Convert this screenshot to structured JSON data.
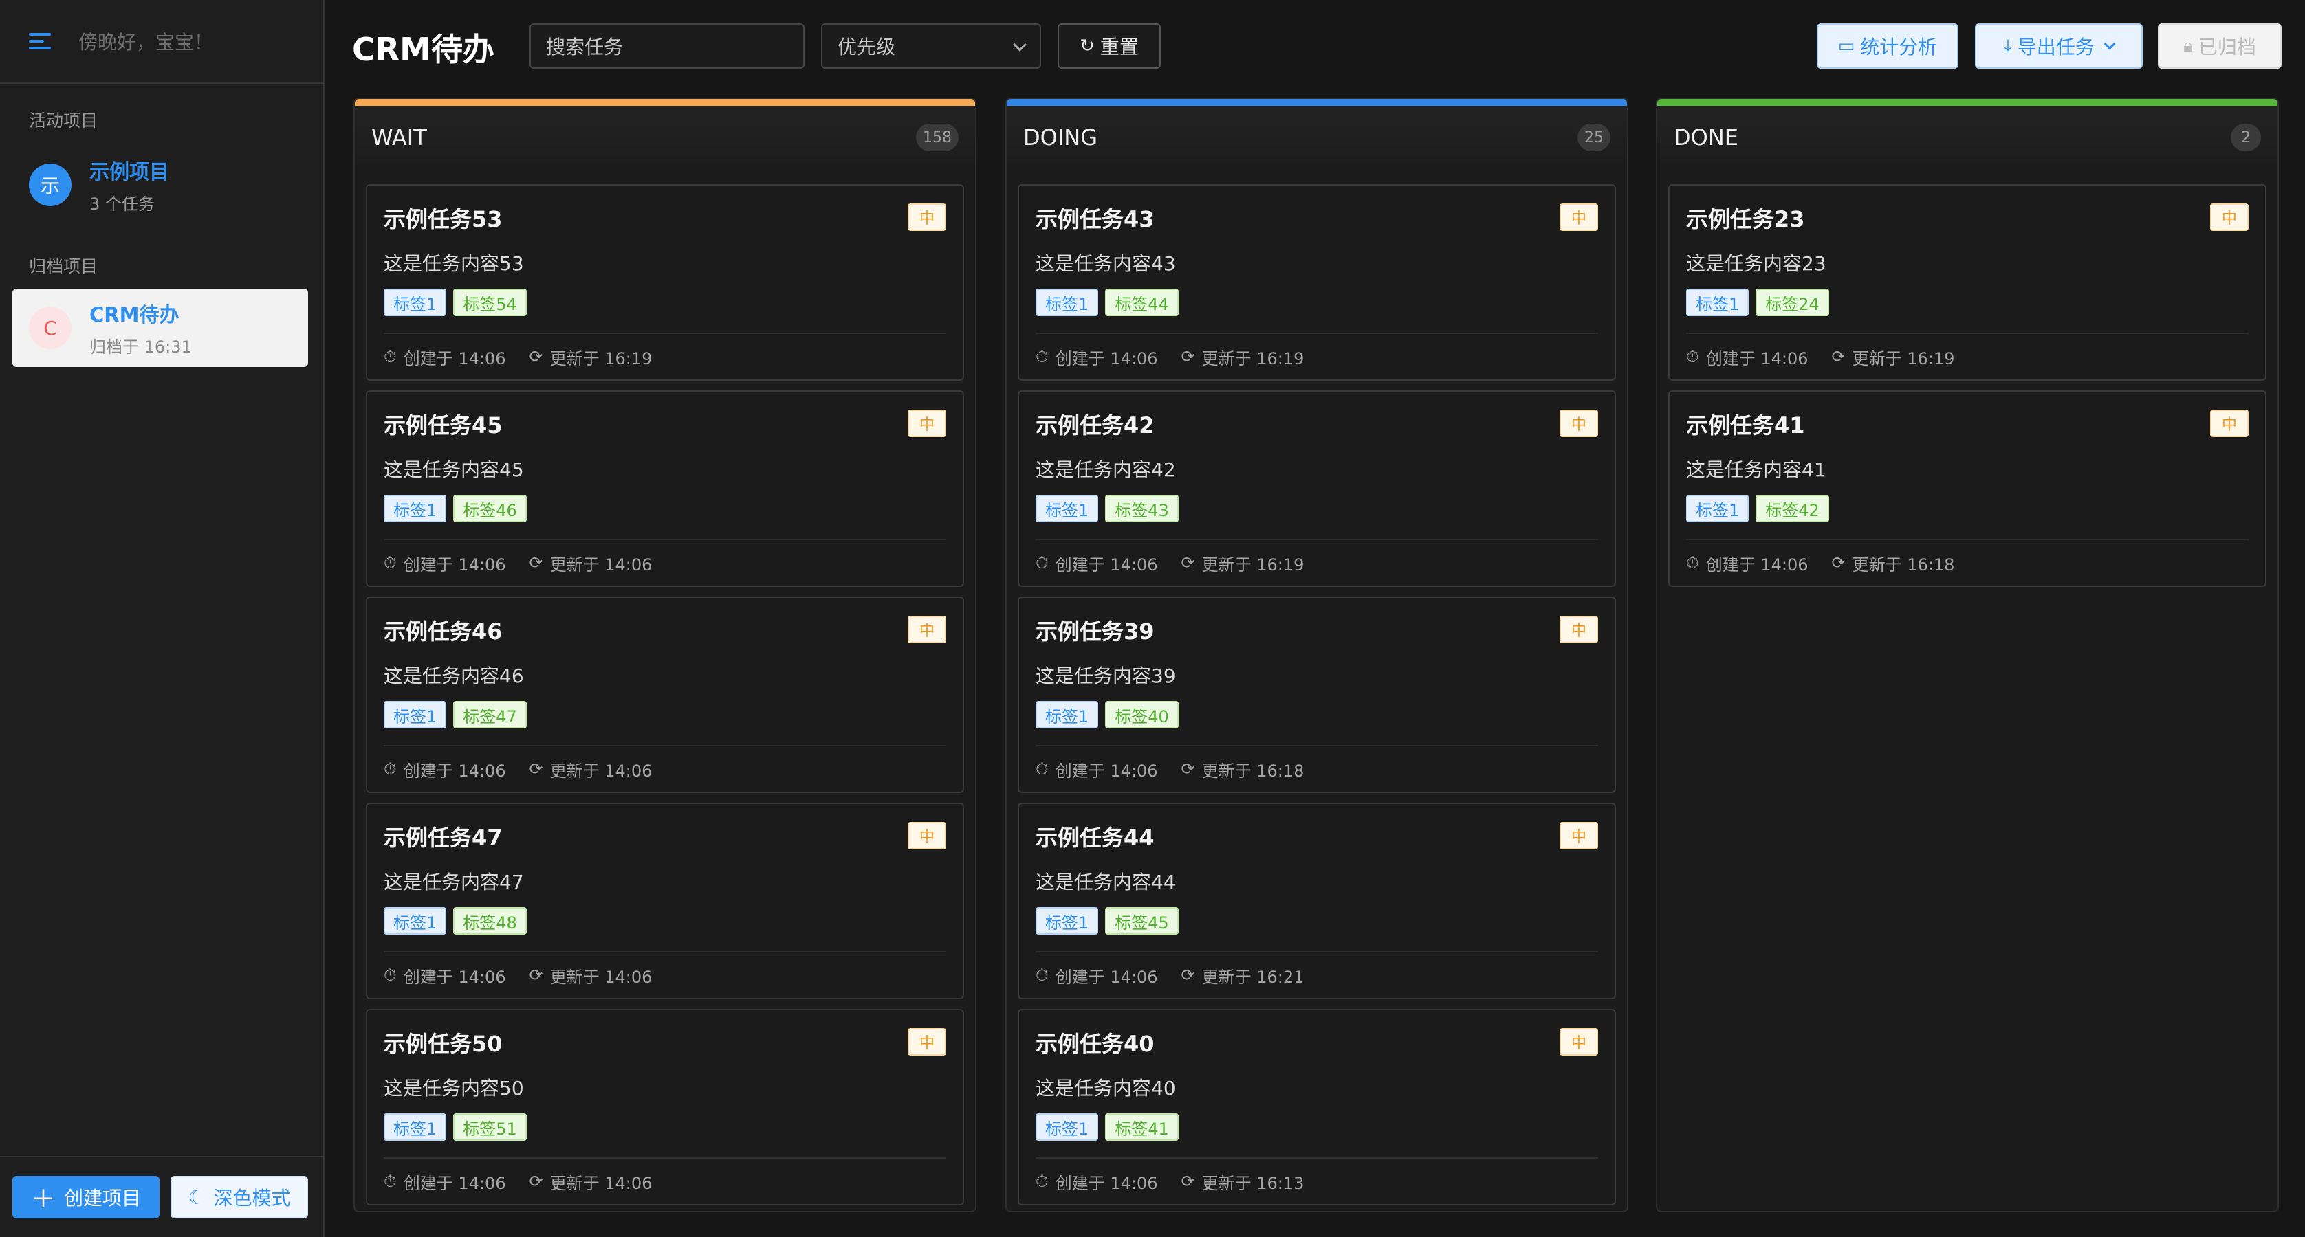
{
  "sidebar": {
    "greeting": "傍晚好，宝宝！",
    "active_title": "活动项目",
    "active_project": {
      "avatar": "示",
      "name": "示例项目",
      "sub": "3 个任务"
    },
    "archive_title": "归档项目",
    "archived_project": {
      "avatar": "C",
      "name": "CRM待办",
      "sub": "归档于 16:31"
    },
    "create_label": "创建项目",
    "dark_label": "深色模式",
    "icons": {
      "menu": "menu-icon",
      "plus": "plus-icon",
      "moon": "moon-icon"
    }
  },
  "topbar": {
    "title": "CRM待办",
    "search_placeholder": "搜索任务",
    "priority_placeholder": "优先级",
    "reset_label": "重置",
    "stats_label": "统计分析",
    "export_label": "导出任务",
    "archived_label": "已归档"
  },
  "colors": {
    "accent": "#2f8ff0",
    "wait": "#f5a955",
    "doing": "#3486e6",
    "done": "#56b63a"
  },
  "columns": [
    {
      "title": "WAIT",
      "count": "158",
      "cards": [
        {
          "title": "示例任务53",
          "priority": "中",
          "content": "这是任务内容53",
          "tags": [
            "标签1",
            "标签54"
          ],
          "created": "创建于 14:06",
          "updated": "更新于 16:19"
        },
        {
          "title": "示例任务45",
          "priority": "中",
          "content": "这是任务内容45",
          "tags": [
            "标签1",
            "标签46"
          ],
          "created": "创建于 14:06",
          "updated": "更新于 14:06"
        },
        {
          "title": "示例任务46",
          "priority": "中",
          "content": "这是任务内容46",
          "tags": [
            "标签1",
            "标签47"
          ],
          "created": "创建于 14:06",
          "updated": "更新于 14:06"
        },
        {
          "title": "示例任务47",
          "priority": "中",
          "content": "这是任务内容47",
          "tags": [
            "标签1",
            "标签48"
          ],
          "created": "创建于 14:06",
          "updated": "更新于 14:06"
        },
        {
          "title": "示例任务50",
          "priority": "中",
          "content": "这是任务内容50",
          "tags": [
            "标签1",
            "标签51"
          ],
          "created": "创建于 14:06",
          "updated": "更新于 14:06"
        }
      ]
    },
    {
      "title": "DOING",
      "count": "25",
      "cards": [
        {
          "title": "示例任务43",
          "priority": "中",
          "content": "这是任务内容43",
          "tags": [
            "标签1",
            "标签44"
          ],
          "created": "创建于 14:06",
          "updated": "更新于 16:19"
        },
        {
          "title": "示例任务42",
          "priority": "中",
          "content": "这是任务内容42",
          "tags": [
            "标签1",
            "标签43"
          ],
          "created": "创建于 14:06",
          "updated": "更新于 16:19"
        },
        {
          "title": "示例任务39",
          "priority": "中",
          "content": "这是任务内容39",
          "tags": [
            "标签1",
            "标签40"
          ],
          "created": "创建于 14:06",
          "updated": "更新于 16:18"
        },
        {
          "title": "示例任务44",
          "priority": "中",
          "content": "这是任务内容44",
          "tags": [
            "标签1",
            "标签45"
          ],
          "created": "创建于 14:06",
          "updated": "更新于 16:21"
        },
        {
          "title": "示例任务40",
          "priority": "中",
          "content": "这是任务内容40",
          "tags": [
            "标签1",
            "标签41"
          ],
          "created": "创建于 14:06",
          "updated": "更新于 16:13"
        }
      ]
    },
    {
      "title": "DONE",
      "count": "2",
      "cards": [
        {
          "title": "示例任务23",
          "priority": "中",
          "content": "这是任务内容23",
          "tags": [
            "标签1",
            "标签24"
          ],
          "created": "创建于 14:06",
          "updated": "更新于 16:19"
        },
        {
          "title": "示例任务41",
          "priority": "中",
          "content": "这是任务内容41",
          "tags": [
            "标签1",
            "标签42"
          ],
          "created": "创建于 14:06",
          "updated": "更新于 16:18"
        }
      ]
    }
  ]
}
